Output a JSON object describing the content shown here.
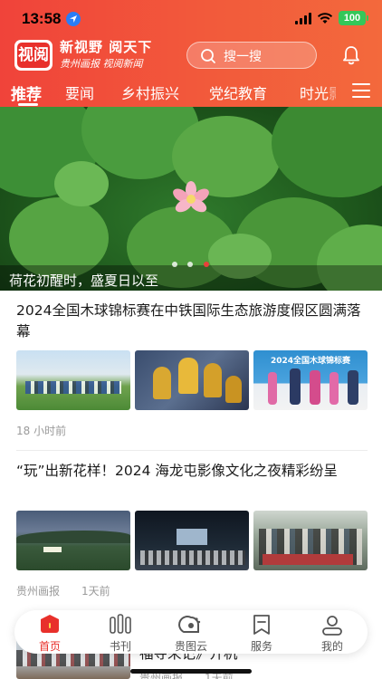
{
  "status_bar": {
    "time": "13:58",
    "battery": "100"
  },
  "header": {
    "logo_glyph": "视阅",
    "slogan": "新视野 阅天下",
    "sub": "贵州画报 视阅新闻",
    "search_placeholder": "搜一搜",
    "tabs": [
      {
        "label": "推荐",
        "active": true
      },
      {
        "label": "要闻"
      },
      {
        "label": "乡村振兴"
      },
      {
        "label": "党纪教育"
      },
      {
        "label": "时光"
      }
    ],
    "clipped_tab_glyph": "影"
  },
  "banner": {
    "caption": "荷花初醒时，盛夏日以至",
    "dots": 3,
    "active_dot": 2
  },
  "articles": [
    {
      "title": "2024全国木球锦标赛在中铁国际生态旅游度假区圆满落幕",
      "thumbnails": [
        "sports-field-crowd",
        "golden-trophies",
        "award-ceremony-stage"
      ],
      "meta": "18 小时前"
    },
    {
      "title": "“玩”出新花样！2024 海龙屯影像文化之夜精彩纷呈",
      "thumbnails": [
        "mountain-valley-night",
        "outdoor-screen-event",
        "crowd-gathering"
      ],
      "meta_source": "贵州画报",
      "meta_time": "1天前"
    },
    {
      "title_partial": "福寺来记》开机",
      "meta_source": "贵州画报",
      "meta_time": "1天前"
    }
  ],
  "bottom_nav": [
    {
      "label": "首页",
      "icon": "home-icon",
      "active": true
    },
    {
      "label": "书刊",
      "icon": "books-icon"
    },
    {
      "label": "贵图云",
      "icon": "cloud-icon"
    },
    {
      "label": "服务",
      "icon": "bookmark-icon"
    },
    {
      "label": "我的",
      "icon": "user-icon"
    }
  ],
  "colors": {
    "brand_red": "#e8302b",
    "header_start": "#f0433a",
    "header_end": "#f3693c"
  }
}
